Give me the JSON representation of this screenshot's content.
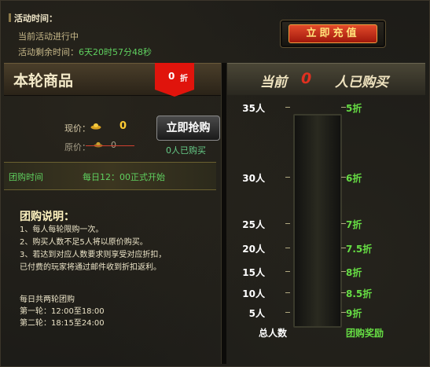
{
  "activity": {
    "time_label": "活动时间：",
    "status": "当前活动进行中",
    "remain_label": "活动剩余时间：",
    "remain_value": "6天20时57分48秒",
    "recharge_label": "立即充值"
  },
  "product": {
    "title": "本轮商品",
    "discount": "0",
    "discount_unit": "折",
    "price_now_label": "现价：",
    "price_now": "0",
    "price_old_label": "原价：",
    "price_old": "0",
    "buy_label": "立即抢购",
    "bought_text": "0人已购买"
  },
  "group_time": {
    "label": "团购时间",
    "value": "每日12：00正式开始"
  },
  "rules": {
    "title": "团购说明：",
    "lines": [
      "1、每人每轮限购一次。",
      "2、购买人数不足5人将以原价购买。",
      "3、若达到对应人数要求则享受对应折扣，",
      "已付费的玩家将通过邮件收到折扣返利。"
    ],
    "schedule": [
      "每日共两轮团购",
      "第一轮：12:00至18:00",
      "第二轮：18:15至24:00"
    ]
  },
  "right": {
    "current_label": "当前",
    "current_count": "0",
    "bought_label": "人已购买",
    "tiers": [
      {
        "people": "35人",
        "discount": "5折"
      },
      {
        "people": "30人",
        "discount": "6折"
      },
      {
        "people": "25人",
        "discount": "7折"
      },
      {
        "people": "20人",
        "discount": "7.5折"
      },
      {
        "people": "15人",
        "discount": "8折"
      },
      {
        "people": "10人",
        "discount": "8.5折"
      },
      {
        "people": "5人",
        "discount": "9折"
      }
    ],
    "footer_left": "总人数",
    "footer_right": "团购奖励"
  },
  "colors": {
    "accent_red": "#e0140c",
    "green": "#66dd44",
    "gold": "#ffcc33"
  }
}
